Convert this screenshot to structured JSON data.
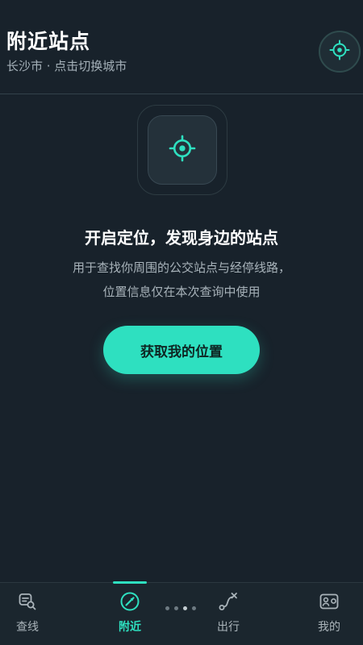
{
  "header": {
    "title": "附近站点",
    "subtitle": "长沙市 · 点击切换城市",
    "locate_icon": "locate-crosshair-icon"
  },
  "hero": {
    "icon": "locate-crosshair-icon",
    "title": "开启定位，发现身边的站点",
    "desc_line1": "用于查找你周围的公交站点与经停线路，",
    "desc_line2": "位置信息仅在本次查询中使用",
    "cta_label": "获取我的位置"
  },
  "nav": {
    "items": [
      {
        "label": "查线",
        "icon": "route-search-icon"
      },
      {
        "label": "附近",
        "icon": "compass-icon",
        "active": true
      },
      {
        "label": "出行",
        "icon": "trip-path-icon"
      },
      {
        "label": "我的",
        "icon": "profile-card-icon"
      }
    ]
  },
  "colors": {
    "background": "#18222b",
    "accent": "#2ee0c0",
    "card": "#24313a",
    "muted_text": "#a8b3ba"
  }
}
